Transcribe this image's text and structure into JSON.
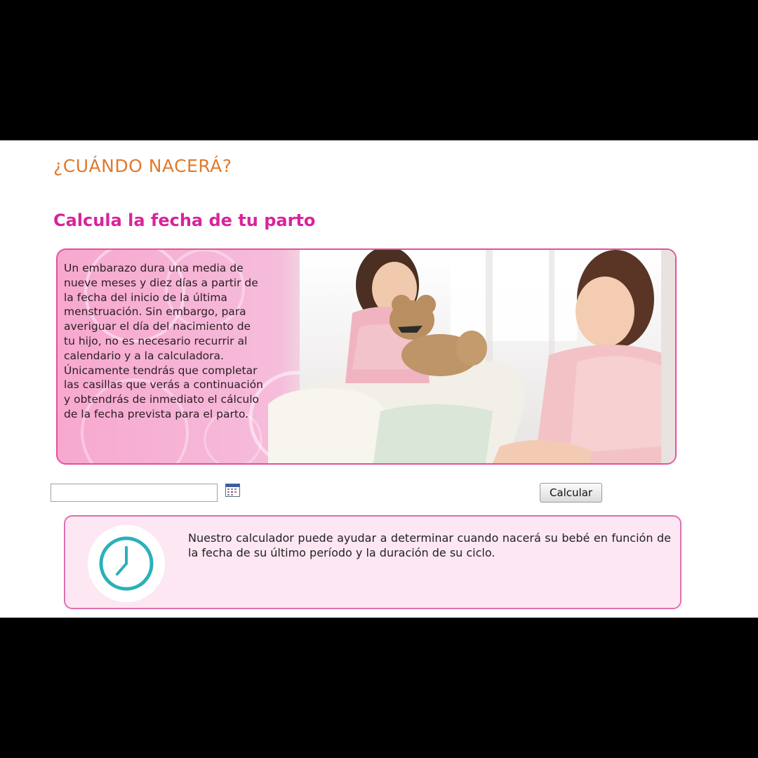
{
  "header": {
    "site_title": "¿CUÁNDO NACERÁ?"
  },
  "main": {
    "section_title": "Calcula la fecha de tu parto",
    "intro_text": "Un embarazo dura una media de nueve meses y diez días a partir de la fecha del inicio de la última menstruación. Sin embargo, para averiguar el día del nacimiento de tu hijo, no es necesario recurrir al calendario y a la calculadora. Únicamente tendrás que completar las casillas que verás a continuación y obtendrás de inmediato el cálculo de la fecha prevista para el parto.",
    "form": {
      "date_value": "",
      "date_placeholder": "",
      "calendar_icon": "calendar-icon",
      "calculate_label": "Calcular"
    },
    "info": {
      "icon": "clock-icon",
      "text": "Nuestro calculador puede ayudar a determinar cuando nacerá su bebé en función de la fecha de su último período y la duración de su ciclo."
    }
  },
  "colors": {
    "site_title": "#e07a2e",
    "section_title": "#d8249a",
    "banner_border": "#e4509e",
    "info_background": "#fde7f3",
    "clock": "#2bb0b8"
  }
}
